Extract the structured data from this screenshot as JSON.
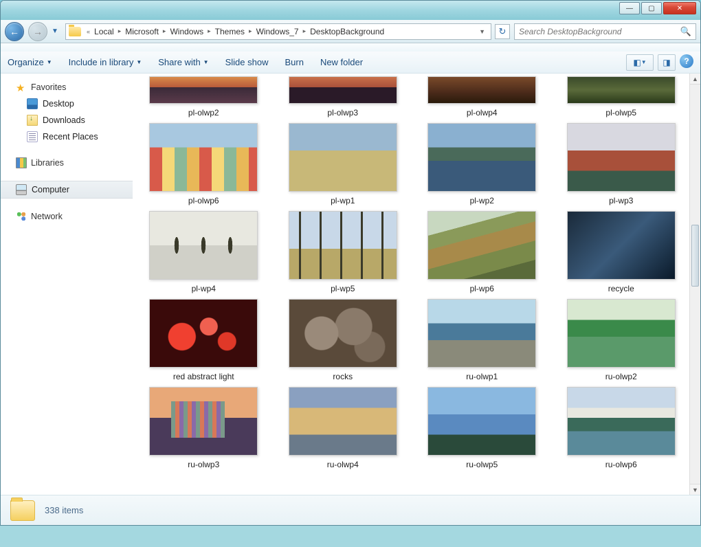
{
  "titlebar": {
    "minimize": "—",
    "maximize": "▢",
    "close": "✕"
  },
  "nav": {
    "back_aria": "Back",
    "forward_aria": "Forward",
    "history_aria": "Recent pages",
    "refresh_aria": "Refresh"
  },
  "breadcrumb": {
    "overflow": "«",
    "parts": [
      "Local",
      "Microsoft",
      "Windows",
      "Themes",
      "Windows_7",
      "DesktopBackground"
    ]
  },
  "search": {
    "placeholder": "Search DesktopBackground"
  },
  "toolbar": {
    "organize": "Organize",
    "include": "Include in library",
    "share": "Share with",
    "slideshow": "Slide show",
    "burn": "Burn",
    "newfolder": "New folder",
    "view_aria": "Change your view",
    "preview_aria": "Show the preview pane",
    "help_aria": "Get help"
  },
  "sidebar": {
    "favorites": "Favorites",
    "desktop": "Desktop",
    "downloads": "Downloads",
    "recent": "Recent Places",
    "libraries": "Libraries",
    "computer": "Computer",
    "network": "Network"
  },
  "items": [
    {
      "name": "pl-olwp2",
      "cut": true,
      "cls": "t-sunset"
    },
    {
      "name": "pl-olwp3",
      "cut": true,
      "cls": "t-sunset2"
    },
    {
      "name": "pl-olwp4",
      "cut": true,
      "cls": "t-brown"
    },
    {
      "name": "pl-olwp5",
      "cut": true,
      "cls": "t-forest"
    },
    {
      "name": "pl-olwp6",
      "cls": "t-houses"
    },
    {
      "name": "pl-wp1",
      "cls": "t-field"
    },
    {
      "name": "pl-wp2",
      "cls": "t-lake"
    },
    {
      "name": "pl-wp3",
      "cls": "t-castle"
    },
    {
      "name": "pl-wp4",
      "cls": "t-reflect"
    },
    {
      "name": "pl-wp5",
      "cls": "t-trees"
    },
    {
      "name": "pl-wp6",
      "cls": "t-hills"
    },
    {
      "name": "recycle",
      "cls": "t-recycle"
    },
    {
      "name": "red abstract light",
      "cls": "t-redabs"
    },
    {
      "name": "rocks",
      "cls": "t-rocks"
    },
    {
      "name": "ru-olwp1",
      "cls": "t-shore"
    },
    {
      "name": "ru-olwp2",
      "cls": "t-greenlake"
    },
    {
      "name": "ru-olwp3",
      "cls": "t-moscow"
    },
    {
      "name": "ru-olwp4",
      "cls": "t-palace"
    },
    {
      "name": "ru-olwp5",
      "cls": "t-bluecliff"
    },
    {
      "name": "ru-olwp6",
      "cls": "t-mtlake"
    }
  ],
  "status": {
    "count": "338 items"
  }
}
